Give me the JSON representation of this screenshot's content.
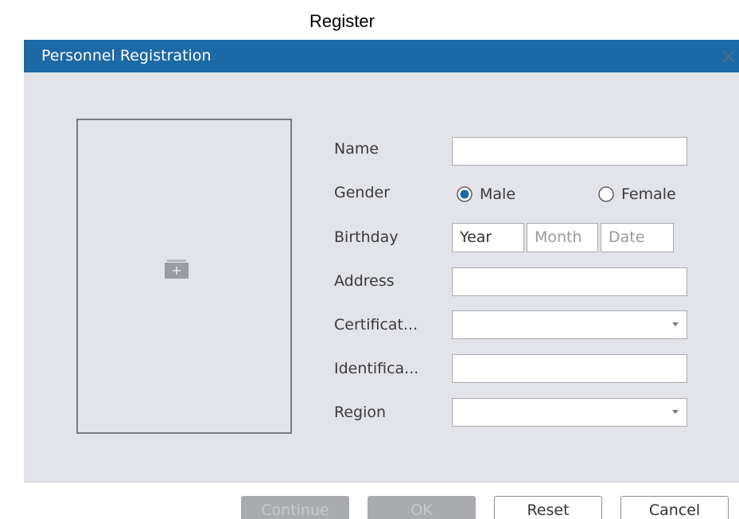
{
  "page": {
    "heading": "Register"
  },
  "dialog": {
    "title": "Personnel Registration",
    "close_icon": "close-x-icon",
    "photo": {
      "icon": "add-photo-icon"
    },
    "form": {
      "name": {
        "label": "Name",
        "value": ""
      },
      "gender": {
        "label": "Gender",
        "options": [
          "Male",
          "Female"
        ],
        "selected": "Male"
      },
      "birthday": {
        "label": "Birthday",
        "year": "Year",
        "month_placeholder": "Month",
        "date_placeholder": "Date"
      },
      "address": {
        "label": "Address",
        "value": ""
      },
      "certificate": {
        "label": "Certificat...",
        "value": ""
      },
      "identification": {
        "label": "Identifica...",
        "value": ""
      },
      "region": {
        "label": "Region",
        "value": ""
      }
    },
    "buttons": {
      "continue": "Continue",
      "ok": "OK",
      "reset": "Reset",
      "cancel": "Cancel"
    }
  },
  "colors": {
    "titlebar": "#1c69a5",
    "body_background": "#e3e4ea",
    "radio_selected": "#1c69a5",
    "disabled_button": "#a9abaf"
  }
}
